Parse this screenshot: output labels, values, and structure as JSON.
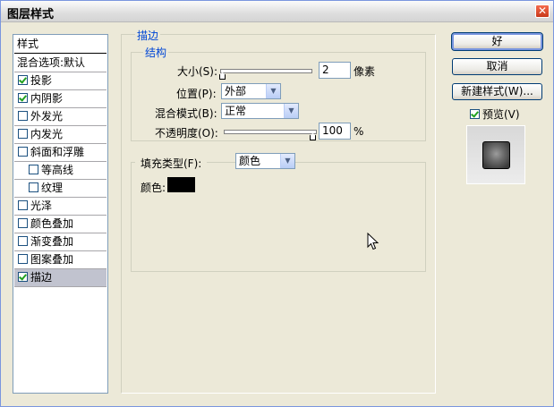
{
  "window": {
    "title": "图层样式",
    "close_glyph": "✕"
  },
  "style_list": {
    "header": "样式",
    "items": [
      {
        "label": "混合选项:默认",
        "checkbox": false,
        "checked": false
      },
      {
        "label": "投影",
        "checkbox": true,
        "checked": true
      },
      {
        "label": "内阴影",
        "checkbox": true,
        "checked": true
      },
      {
        "label": "外发光",
        "checkbox": true,
        "checked": false
      },
      {
        "label": "内发光",
        "checkbox": true,
        "checked": false
      },
      {
        "label": "斜面和浮雕",
        "checkbox": true,
        "checked": false
      },
      {
        "label": "等高线",
        "checkbox": true,
        "checked": false
      },
      {
        "label": "纹理",
        "checkbox": true,
        "checked": false
      },
      {
        "label": "光泽",
        "checkbox": true,
        "checked": false
      },
      {
        "label": "颜色叠加",
        "checkbox": true,
        "checked": false
      },
      {
        "label": "渐变叠加",
        "checkbox": true,
        "checked": false
      },
      {
        "label": "图案叠加",
        "checkbox": true,
        "checked": false
      },
      {
        "label": "描边",
        "checkbox": true,
        "checked": true
      }
    ]
  },
  "stroke": {
    "section_title": "描边",
    "structure_title": "结构",
    "size_label": "大小(S):",
    "size_value": "2",
    "size_unit": "像素",
    "position_label": "位置(P):",
    "position_value": "外部",
    "blend_label": "混合模式(B):",
    "blend_value": "正常",
    "opacity_label": "不透明度(O):",
    "opacity_value": "100",
    "opacity_unit": "%",
    "fill_type_label": "填充类型(F):",
    "fill_type_value": "颜色",
    "color_label": "颜色:",
    "color_value": "#000000"
  },
  "buttons": {
    "ok": "好",
    "cancel": "取消",
    "new_style": "新建样式(W)...",
    "preview": "预览(V)"
  },
  "colors": {
    "accent": "#0046d5",
    "selected_row": "#c1c3cf"
  }
}
